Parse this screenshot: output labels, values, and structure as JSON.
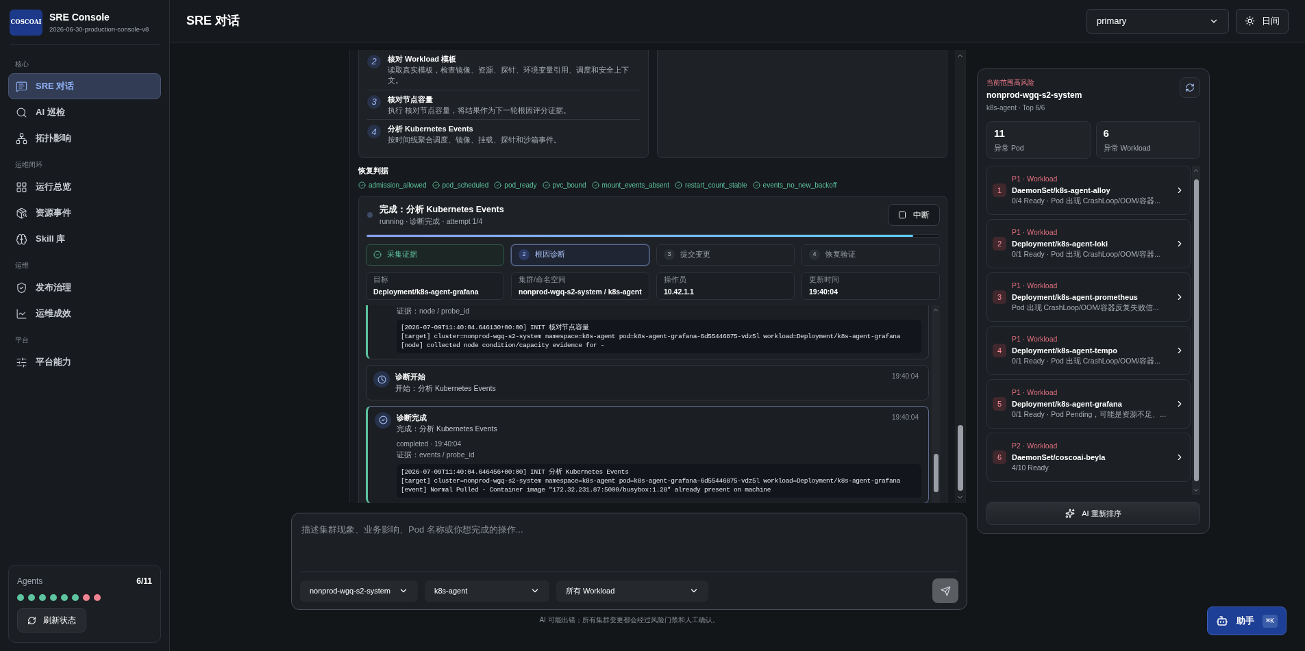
{
  "brand": {
    "logo": "COSCOAI",
    "title": "SRE Console",
    "version": "2026-06-30-production-console-v8"
  },
  "sidebar": {
    "sections": [
      {
        "label": "核心",
        "items": [
          {
            "label": "SRE 对话",
            "selected": true
          },
          {
            "label": "AI 巡检",
            "selected": false
          },
          {
            "label": "拓扑影响",
            "selected": false
          }
        ]
      },
      {
        "label": "运维闭环",
        "items": [
          {
            "label": "运行总览",
            "selected": false
          },
          {
            "label": "资源事件",
            "selected": false
          },
          {
            "label": "Skill 库",
            "selected": false
          }
        ]
      },
      {
        "label": "运维",
        "items": [
          {
            "label": "发布治理",
            "selected": false
          },
          {
            "label": "运维成效",
            "selected": false
          }
        ]
      },
      {
        "label": "平台",
        "items": [
          {
            "label": "平台能力",
            "selected": false
          }
        ]
      }
    ],
    "agents": {
      "label": "Agents",
      "count": "6/11",
      "dots": [
        {
          "color": "#5ec4a0"
        },
        {
          "color": "#5ec4a0"
        },
        {
          "color": "#5ec4a0"
        },
        {
          "color": "#5ec4a0"
        },
        {
          "color": "#5ec4a0"
        },
        {
          "color": "#5ec4a0"
        },
        {
          "color": "#f08392"
        },
        {
          "color": "#f08392"
        }
      ],
      "button": "刷新状态"
    }
  },
  "header": {
    "title": "SRE 对话",
    "profile": "primary",
    "theme_button": "日间"
  },
  "plan_steps": [
    {
      "number": "2",
      "title": "核对 Workload 模板",
      "desc": "读取真实模板，检查镜像、资源、探针、环境变量引用、调度和安全上下文。"
    },
    {
      "number": "3",
      "title": "核对节点容量",
      "desc": "执行 核对节点容量，将结果作为下一轮根因评分证据。"
    },
    {
      "number": "4",
      "title": "分析 Kubernetes Events",
      "desc": "按时间线聚合调度、镜像、挂载、探针和沙箱事件。"
    }
  ],
  "recovery": {
    "title": "恢复判据",
    "criteria": [
      "admission_allowed",
      "pod_scheduled",
      "pod_ready",
      "pvc_bound",
      "mount_events_absent",
      "restart_count_stable",
      "events_no_new_backoff"
    ]
  },
  "run": {
    "title": "完成：分析 Kubernetes Events",
    "subtitle": "running · 诊断完成 · attempt 1/4",
    "stop_button": "中断",
    "level": 0.955,
    "stages": [
      {
        "label": "采集证据",
        "done": true,
        "selected": false
      },
      {
        "number": "2",
        "label": "根因诊断",
        "done": false,
        "selected": true
      },
      {
        "number": "3",
        "label": "提交变更",
        "done": false,
        "selected": false
      },
      {
        "number": "4",
        "label": "恢复验证",
        "done": false,
        "selected": false
      }
    ],
    "facts": [
      {
        "label": "目标",
        "value": "Deployment/k8s-agent-grafana"
      },
      {
        "label": "集群/命名空间",
        "value": "nonprod-wgq-s2-system / k8s-agent"
      },
      {
        "label": "操作员",
        "value": "10.42.1.1"
      },
      {
        "label": "更新时间",
        "value": "19:40:04"
      }
    ],
    "log": [
      {
        "kind": "fragment",
        "selected": false,
        "evidence": "证据：node / probe_id",
        "code": [
          "[2026-07-09T11:40:04.646130+00:00] INIT 核对节点容量",
          "[target] cluster=nonprod-wgq-s2-system namespace=k8s-agent pod=k8s-agent-grafana-6d55446875-vdz5l workload=Deployment/k8s-agent-grafana",
          "[node] collected node condition/capacity evidence for -"
        ]
      },
      {
        "kind": "started",
        "selected": false,
        "title": "诊断开始",
        "subtitle": "开始：分析 Kubernetes Events",
        "time": "19:40:04"
      },
      {
        "kind": "completed",
        "selected": true,
        "title": "诊断完成",
        "subtitle": "完成：分析 Kubernetes Events",
        "time": "19:40:04",
        "status": "completed · 19:40:04",
        "evidence": "证据：events / probe_id",
        "code": [
          "[2026-07-09T11:40:04.646456+00:00] INIT 分析 Kubernetes Events",
          "[target] cluster=nonprod-wgq-s2-system namespace=k8s-agent pod=k8s-agent-grafana-6d55446875-vdz5l workload=Deployment/k8s-agent-grafana",
          "[event] Normal Pulled - Container image \"172.32.231.87:5000/busybox:1.28\" already present on machine"
        ]
      }
    ]
  },
  "composer": {
    "placeholder": "描述集群现象、业务影响、Pod 名称或你想完成的操作...",
    "selects": [
      "nonprod-wgq-s2-system",
      "k8s-agent",
      "所有 Workload"
    ],
    "disclaimer": "AI 可能出错；所有集群变更都会经过风险门禁和人工确认。"
  },
  "risk": {
    "eyebrow": "当前范围高风险",
    "cluster": "nonprod-wgq-s2-system",
    "meta": "k8s-agent · Top 6/6",
    "stats": [
      {
        "value": "11",
        "label": "异常 Pod"
      },
      {
        "value": "6",
        "label": "异常 Workload"
      }
    ],
    "items": [
      {
        "rank": "1",
        "tag": "P1 · Workload",
        "name": "DaemonSet/k8s-agent-alloy",
        "desc": "0/4 Ready · Pod 出现 CrashLoop/OOM/容器..."
      },
      {
        "rank": "2",
        "tag": "P1 · Workload",
        "name": "Deployment/k8s-agent-loki",
        "desc": "0/1 Ready · Pod 出现 CrashLoop/OOM/容器..."
      },
      {
        "rank": "3",
        "tag": "P1 · Workload",
        "name": "Deployment/k8s-agent-prometheus",
        "desc": "Pod 出现 CrashLoop/OOM/容器反复失败信..."
      },
      {
        "rank": "4",
        "tag": "P1 · Workload",
        "name": "Deployment/k8s-agent-tempo",
        "desc": "0/1 Ready · Pod 出现 CrashLoop/OOM/容器..."
      },
      {
        "rank": "5",
        "tag": "P1 · Workload",
        "name": "Deployment/k8s-agent-grafana",
        "desc": "0/1 Ready · Pod Pending，可能是资源不足、..."
      },
      {
        "rank": "6",
        "tag": "P2 · Workload",
        "name": "DaemonSet/coscoai-beyla",
        "desc": "4/10 Ready"
      }
    ],
    "rerank_button": "AI 重新排序"
  },
  "assistant": {
    "label": "助手",
    "shortcut": "⌘K"
  }
}
